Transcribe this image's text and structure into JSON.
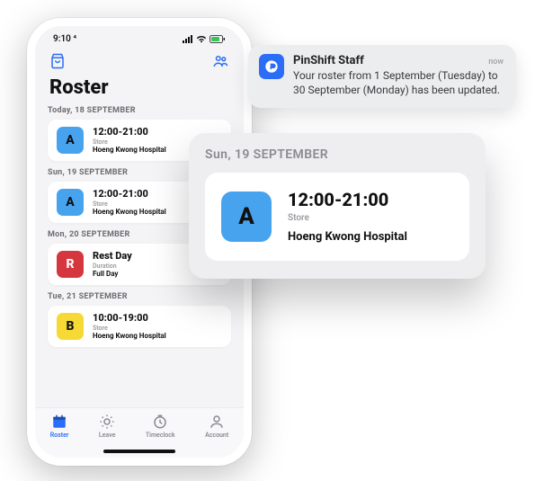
{
  "colors": {
    "blue": "#48a3ef",
    "red": "#d6363e",
    "yellow": "#f6d934",
    "accent": "#2b6df6"
  },
  "status": {
    "time": "9:10 ⁴"
  },
  "header": {
    "title": "Roster"
  },
  "days": [
    {
      "label": "Today, 18 SEPTEMBER",
      "badge_letter": "A",
      "badge_color_key": "blue",
      "time": "12:00-21:00",
      "role": "Store",
      "location": "Hoeng Kwong Hospital"
    },
    {
      "label": "Sun, 19 SEPTEMBER",
      "badge_letter": "A",
      "badge_color_key": "blue",
      "time": "12:00-21:00",
      "role": "Store",
      "location": "Hoeng Kwong Hospital"
    },
    {
      "label": "Mon, 20 SEPTEMBER",
      "badge_letter": "R",
      "badge_color_key": "red",
      "time": "Rest Day",
      "role": "Duration",
      "location": "Full Day"
    },
    {
      "label": "Tue, 21 SEPTEMBER",
      "badge_letter": "B",
      "badge_color_key": "yellow",
      "time": "10:00-19:00",
      "role": "Store",
      "location": "Hoeng Kwong Hospital"
    }
  ],
  "tabbar": {
    "items": [
      {
        "label": "Roster",
        "icon": "calendar-icon",
        "active": true
      },
      {
        "label": "Leave",
        "icon": "sun-icon",
        "active": false
      },
      {
        "label": "Timeclock",
        "icon": "clock-icon",
        "active": false
      },
      {
        "label": "Account",
        "icon": "person-icon",
        "active": false
      }
    ]
  },
  "float": {
    "day_label": "Sun, 19 SEPTEMBER",
    "badge_letter": "A",
    "badge_color_key": "blue",
    "time": "12:00-21:00",
    "role": "Store",
    "location": "Hoeng Kwong Hospital"
  },
  "notification": {
    "app": "PinShift Staff",
    "when": "now",
    "message": "Your roster from 1 September (Tuesday) to 30 September (Monday) has been updated."
  }
}
